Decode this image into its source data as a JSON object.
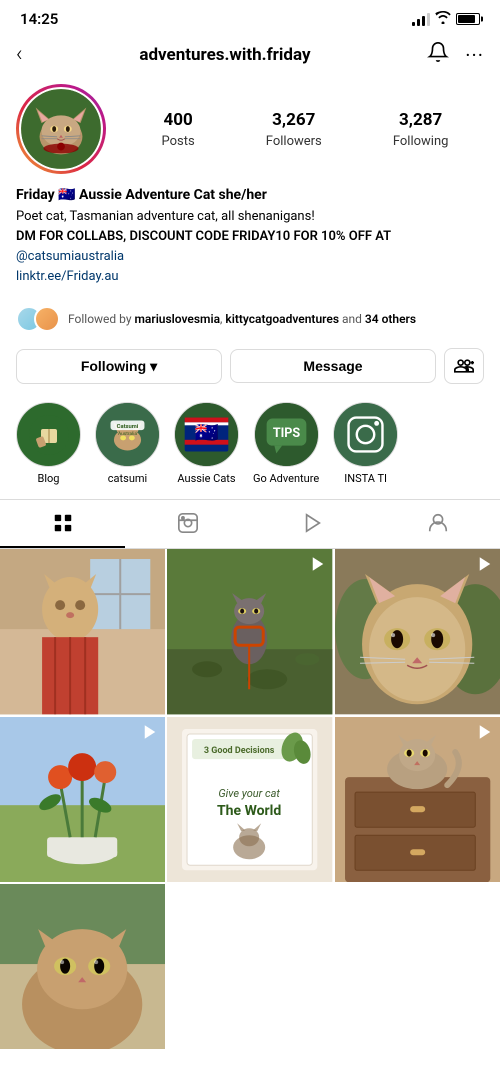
{
  "status": {
    "time": "14:25"
  },
  "header": {
    "username": "adventures.with.friday",
    "back_label": "‹"
  },
  "profile": {
    "stats": {
      "posts_count": "400",
      "posts_label": "Posts",
      "followers_count": "3,267",
      "followers_label": "Followers",
      "following_count": "3,287",
      "following_label": "Following"
    },
    "bio": {
      "name": "Friday 🇦🇺 Aussie Adventure Cat she/her",
      "line1": "Poet cat, Tasmanian adventure cat, all shenanigans!",
      "line2": "DM FOR COLLABS, DISCOUNT CODE FRIDAY10 FOR 10% OFF AT",
      "link1": "@catsumiaustralia",
      "link2": "linktr.ee/Friday.au"
    },
    "mutual": {
      "text": "Followed by mariuslovesmia, kittycatgoadventures and 34 others"
    },
    "buttons": {
      "following": "Following",
      "following_arrow": "▾",
      "message": "Message"
    }
  },
  "highlights": [
    {
      "label": "Blog",
      "emoji": "✋"
    },
    {
      "label": "catsumi",
      "emoji": "🐱"
    },
    {
      "label": "Aussie Cats",
      "emoji": "🇦🇺"
    },
    {
      "label": "Go Adventure",
      "text": "TIPS"
    },
    {
      "label": "INSTA TI",
      "emoji": "📸"
    }
  ],
  "tabs": [
    {
      "label": "grid",
      "active": true
    },
    {
      "label": "reels"
    },
    {
      "label": "play"
    },
    {
      "label": "tagged"
    }
  ],
  "grid": {
    "items": [
      {
        "id": 1,
        "type": "image",
        "has_video": false
      },
      {
        "id": 2,
        "type": "video",
        "has_video": true
      },
      {
        "id": 3,
        "type": "video",
        "has_video": true
      },
      {
        "id": 4,
        "type": "video",
        "has_video": true
      },
      {
        "id": 5,
        "type": "image",
        "has_video": false
      },
      {
        "id": 6,
        "type": "image",
        "has_video": false
      },
      {
        "id": 7,
        "type": "image",
        "has_video": false
      }
    ]
  }
}
